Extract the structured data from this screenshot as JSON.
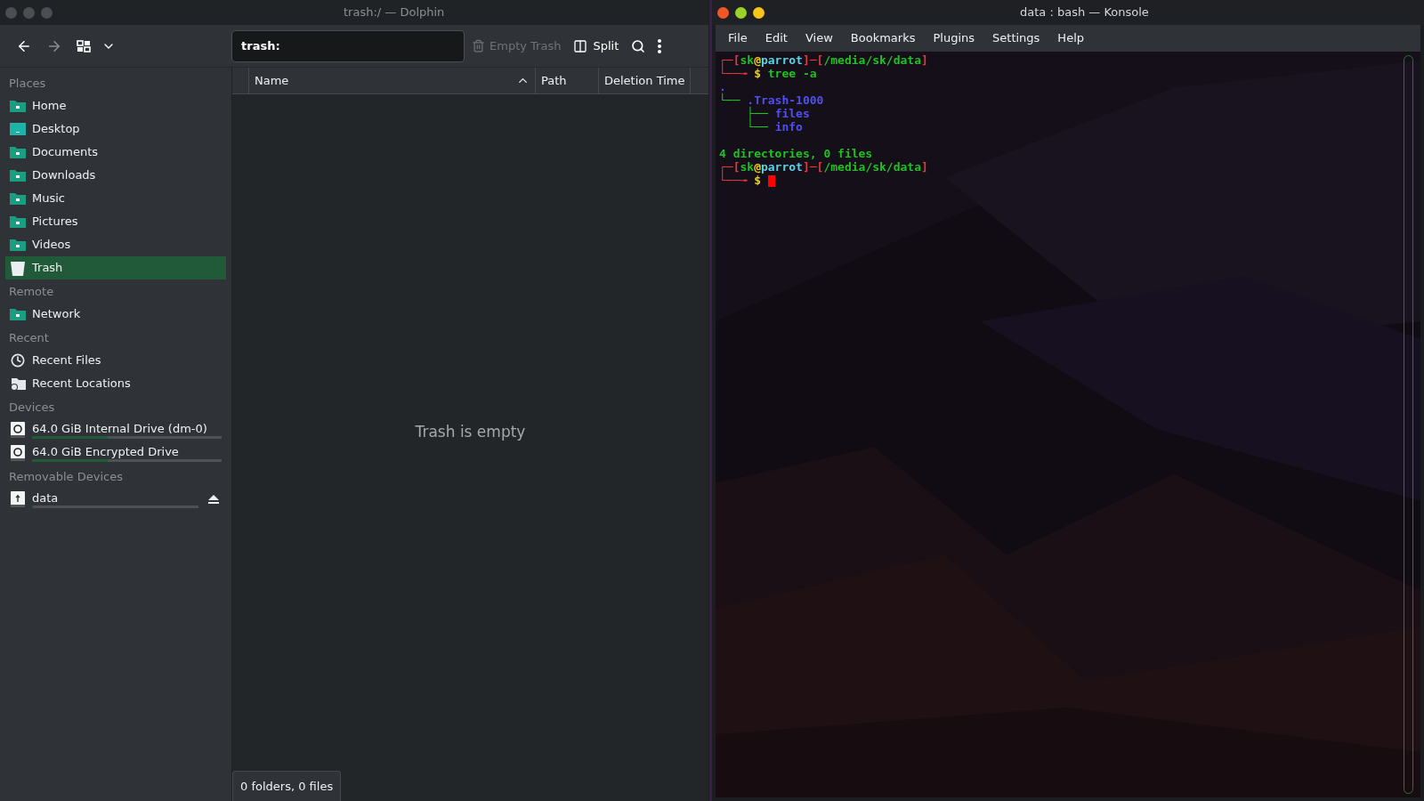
{
  "dolphin": {
    "title": "trash:/ — Dolphin",
    "toolbar": {
      "location": "trash:",
      "empty_trash": {
        "label": "Empty Trash",
        "disabled": true
      },
      "split": "Split"
    },
    "sidebar": [
      {
        "heading": "Places",
        "items": [
          {
            "label": "Home",
            "kind": "folder",
            "selected": false
          },
          {
            "label": "Desktop",
            "kind": "desktop",
            "selected": false
          },
          {
            "label": "Documents",
            "kind": "folder",
            "selected": false
          },
          {
            "label": "Downloads",
            "kind": "folder",
            "selected": false
          },
          {
            "label": "Music",
            "kind": "folder",
            "selected": false
          },
          {
            "label": "Pictures",
            "kind": "folder",
            "selected": false
          },
          {
            "label": "Videos",
            "kind": "folder",
            "selected": false
          },
          {
            "label": "Trash",
            "kind": "trash",
            "selected": true
          }
        ]
      },
      {
        "heading": "Remote",
        "items": [
          {
            "label": "Network",
            "kind": "folder",
            "selected": false
          }
        ]
      },
      {
        "heading": "Recent",
        "items": [
          {
            "label": "Recent Files",
            "kind": "clock",
            "selected": false
          },
          {
            "label": "Recent Locations",
            "kind": "recent-folder",
            "selected": false
          }
        ]
      },
      {
        "heading": "Devices",
        "items": [
          {
            "label": "64.0 GiB Internal Drive (dm-0)",
            "kind": "drive",
            "selected": false,
            "level": 0.4
          },
          {
            "label": "64.0 GiB Encrypted Drive",
            "kind": "drive",
            "selected": false,
            "level": 0.4
          }
        ]
      },
      {
        "heading": "Removable Devices",
        "items": [
          {
            "label": "data",
            "kind": "usb",
            "selected": false,
            "level": 0.01,
            "ejectable": true
          }
        ]
      }
    ],
    "columns": [
      {
        "label": "Name",
        "sorted": true
      },
      {
        "label": "Path",
        "sorted": false
      },
      {
        "label": "Deletion Time",
        "sorted": false
      }
    ],
    "empty_message": "Trash is empty",
    "status": "0 folders, 0 files"
  },
  "konsole": {
    "title": "data : bash — Konsole",
    "menu": [
      "File",
      "Edit",
      "View",
      "Bookmarks",
      "Plugins",
      "Settings",
      "Help"
    ],
    "lines": [
      {
        "blank_before": false,
        "cursor": false,
        "segments": [
          {
            "text": "┌─[",
            "color": "#e0393e"
          },
          {
            "text": "sk",
            "color": "#1fc21f"
          },
          {
            "text": "@",
            "color": "#f2d21b"
          },
          {
            "text": "parrot",
            "color": "#54d6e8"
          },
          {
            "text": "]─[",
            "color": "#e0393e"
          },
          {
            "text": "/media/sk/data",
            "color": "#1fc21f"
          },
          {
            "text": "]",
            "color": "#e0393e"
          }
        ]
      },
      {
        "blank_before": false,
        "cursor": false,
        "segments": [
          {
            "text": "└──╼ ",
            "color": "#e0393e"
          },
          {
            "text": "$ ",
            "color": "#f2d21b"
          },
          {
            "text": "tree -a",
            "color": "#1fc21f"
          }
        ]
      },
      {
        "blank_before": false,
        "cursor": false,
        "segments": [
          {
            "text": ".",
            "color": "#5050f0"
          }
        ]
      },
      {
        "blank_before": false,
        "cursor": false,
        "segments": [
          {
            "text": "└── ",
            "color": "#1fc21f"
          },
          {
            "text": ".Trash-1000",
            "color": "#5050f0"
          }
        ]
      },
      {
        "blank_before": false,
        "cursor": false,
        "segments": [
          {
            "text": "    ├── ",
            "color": "#1fc21f"
          },
          {
            "text": "files",
            "color": "#5050f0"
          }
        ]
      },
      {
        "blank_before": false,
        "cursor": false,
        "segments": [
          {
            "text": "    └── ",
            "color": "#1fc21f"
          },
          {
            "text": "info",
            "color": "#5050f0"
          }
        ]
      },
      {
        "blank_before": true,
        "cursor": false,
        "segments": [
          {
            "text": "4 directories, 0 files",
            "color": "#1fc21f"
          }
        ]
      },
      {
        "blank_before": false,
        "cursor": false,
        "segments": [
          {
            "text": "┌─[",
            "color": "#e0393e"
          },
          {
            "text": "sk",
            "color": "#1fc21f"
          },
          {
            "text": "@",
            "color": "#f2d21b"
          },
          {
            "text": "parrot",
            "color": "#54d6e8"
          },
          {
            "text": "]─[",
            "color": "#e0393e"
          },
          {
            "text": "/media/sk/data",
            "color": "#1fc21f"
          },
          {
            "text": "]",
            "color": "#e0393e"
          }
        ]
      },
      {
        "blank_before": false,
        "cursor": true,
        "segments": [
          {
            "text": "└──╼ ",
            "color": "#e0393e"
          },
          {
            "text": "$ ",
            "color": "#f2d21b"
          }
        ]
      }
    ]
  }
}
